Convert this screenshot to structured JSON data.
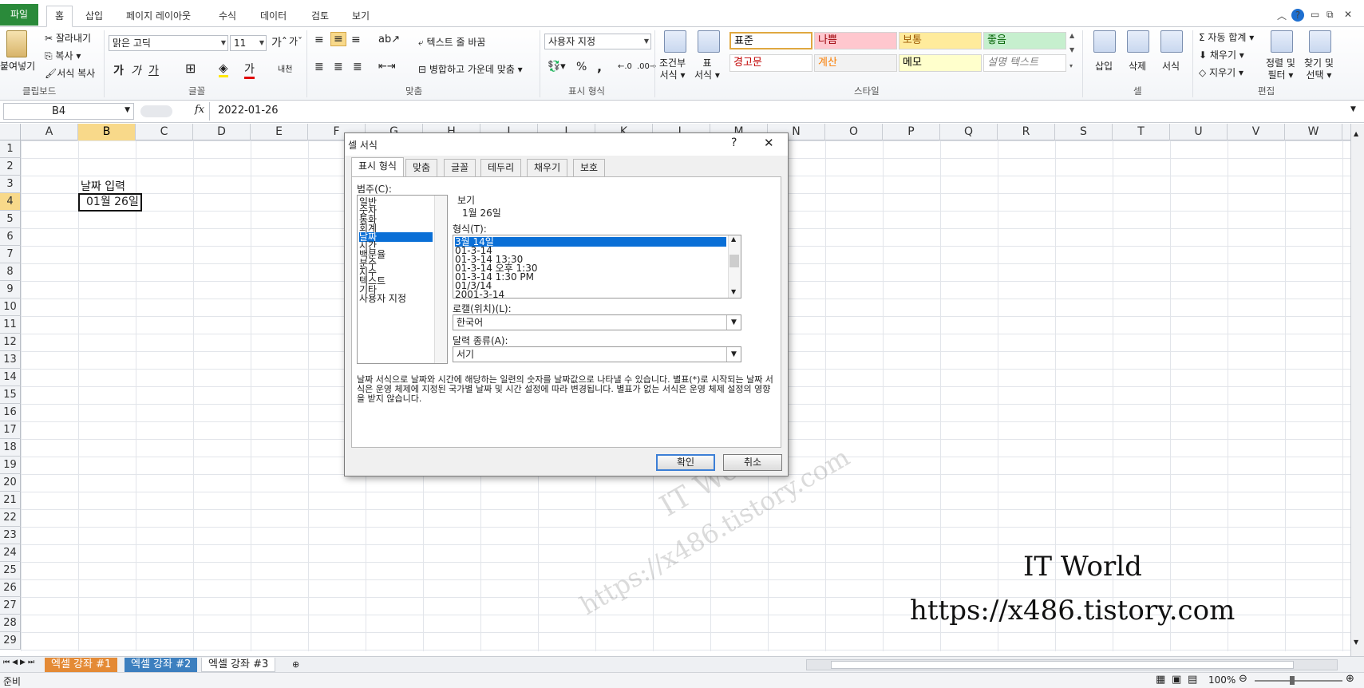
{
  "ribbon": {
    "tabs": [
      "파일",
      "홈",
      "삽입",
      "페이지 레이아웃",
      "수식",
      "데이터",
      "검토",
      "보기"
    ],
    "active_tab": "홈",
    "clipboard": {
      "paste": "붙여넣기",
      "cut": "잘라내기",
      "copy": "복사 ▾",
      "format_painter": "서식 복사",
      "label": "클립보드"
    },
    "font": {
      "name": "맑은 고딕",
      "size": "11",
      "bold": "가",
      "italic": "가",
      "underline": "가",
      "label": "글꼴"
    },
    "alignment": {
      "wrap": "텍스트 줄 바꿈",
      "merge": "병합하고 가운데 맞춤 ▾",
      "label": "맞춤"
    },
    "number": {
      "format": "사용자 지정",
      "percent": "%",
      "comma": ",",
      "label": "표시 형식"
    },
    "styles_group": {
      "conditional": "조건부\n서식 ▾",
      "table": "표\n서식 ▾",
      "label": "스타일"
    },
    "styles": [
      {
        "name": "표준",
        "bg": "#ffffff",
        "fg": "#000000"
      },
      {
        "name": "나쁨",
        "bg": "#ffc7ce",
        "fg": "#9c0006"
      },
      {
        "name": "보통",
        "bg": "#ffeb9c",
        "fg": "#9c5700"
      },
      {
        "name": "좋음",
        "bg": "#c6efce",
        "fg": "#006100"
      },
      {
        "name": "경고문",
        "bg": "#ffffff",
        "fg": "#c00000"
      },
      {
        "name": "계산",
        "bg": "#f2f2f2",
        "fg": "#fa7d00"
      },
      {
        "name": "메모",
        "bg": "#ffffcc",
        "fg": "#000000"
      },
      {
        "name": "설명 텍스트",
        "bg": "#ffffff",
        "fg": "#7f7f7f"
      }
    ],
    "cells": {
      "insert": "삽입",
      "delete": "삭제",
      "format": "서식",
      "label": "셀"
    },
    "editing": {
      "autosum": "자동 합계 ▾",
      "fill": "채우기 ▾",
      "clear": "지우기 ▾",
      "sort": "정렬 및\n필터 ▾",
      "find": "찾기 및\n선택 ▾",
      "label": "편집"
    }
  },
  "formula_bar": {
    "name_box": "B4",
    "fx": "fx",
    "value": "2022-01-26"
  },
  "grid": {
    "columns": [
      "A",
      "B",
      "C",
      "D",
      "E",
      "F",
      "G",
      "H",
      "I",
      "J",
      "K",
      "L",
      "M",
      "N",
      "O",
      "P",
      "Q",
      "R",
      "S",
      "T",
      "U",
      "V",
      "W"
    ],
    "rows": [
      "1",
      "2",
      "3",
      "4",
      "5",
      "6",
      "7",
      "8",
      "9",
      "10",
      "11",
      "12",
      "13",
      "14",
      "15",
      "16",
      "17",
      "18",
      "19",
      "20",
      "21",
      "22",
      "23",
      "24",
      "25",
      "26",
      "27",
      "28",
      "29"
    ],
    "selected_col": "B",
    "selected_row": "4",
    "b3": "날짜 입력",
    "b4": "01월 26일"
  },
  "sheets": {
    "tabs": [
      "엑셀 강좌 #1",
      "엑셀 강좌 #2",
      "엑셀 강좌 #3"
    ],
    "active": "엑셀 강좌 #3"
  },
  "status": {
    "ready": "준비",
    "zoom": "100%"
  },
  "dialog": {
    "title": "셀 서식",
    "help": "?",
    "close": "✕",
    "tabs": [
      "표시 형식",
      "맞춤",
      "글꼴",
      "테두리",
      "채우기",
      "보호"
    ],
    "category_label": "범주(C):",
    "categories": [
      "일반",
      "숫자",
      "통화",
      "회계",
      "날짜",
      "시간",
      "백분율",
      "분수",
      "지수",
      "텍스트",
      "기타",
      "사용자 지정"
    ],
    "selected_category": "날짜",
    "preview_label": "보기",
    "preview_value": "1월 26일",
    "type_label": "형식(T):",
    "types": [
      "3월 14일",
      "01-3-14",
      "01-3-14 13:30",
      "01-3-14 오후 1:30",
      "01-3-14 1:30 PM",
      "01/3/14",
      "2001-3-14"
    ],
    "selected_type": "3월 14일",
    "locale_label": "로캘(위치)(L):",
    "locale_value": "한국어",
    "calendar_label": "달력 종류(A):",
    "calendar_value": "서기",
    "description": "날짜 서식으로 날짜와 시간에 해당하는 일련의 숫자를 날짜값으로 나타낼 수 있습니다. 별표(*)로 시작되는 날짜 서식은 운영 체제에 지정된 국가별 날짜 및 시간 설정에 따라 변경됩니다. 별표가 없는 서식은 운영 체제 설정의 영향을 받지 않습니다.",
    "ok": "확인",
    "cancel": "취소"
  },
  "watermark": {
    "name": "IT World",
    "url": "https://x486.tistory.com"
  },
  "colors": {
    "file_tab": "#2a8a3a",
    "selection_blue": "#0a6fd6",
    "header_highlight": "#f8d98a"
  }
}
